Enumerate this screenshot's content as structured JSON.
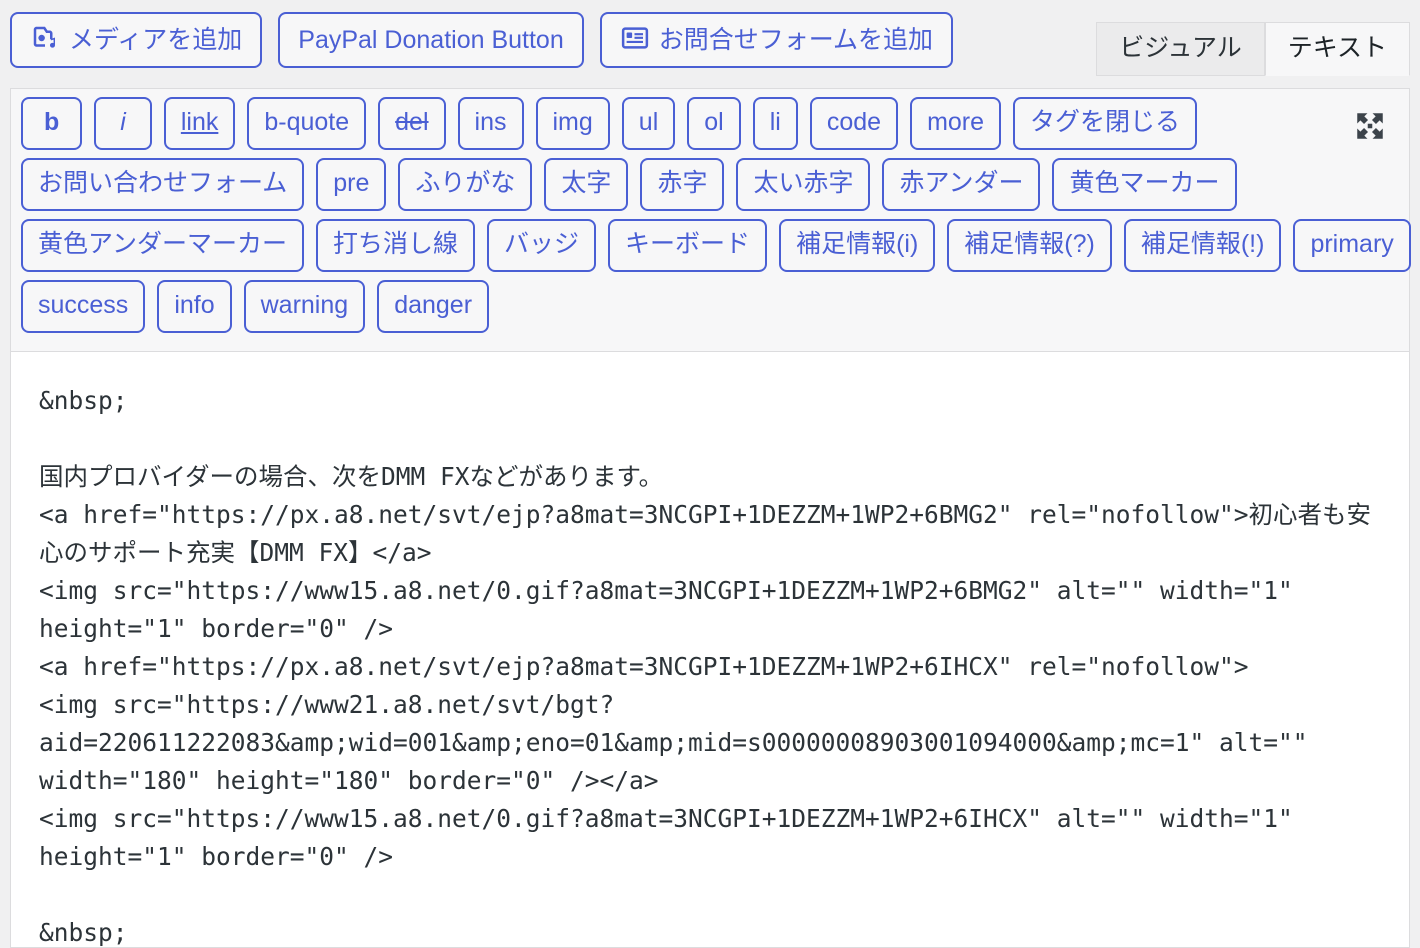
{
  "media_bar": {
    "buttons": [
      {
        "label": "メディアを追加",
        "icon": "media-add-icon",
        "has_icon": true
      },
      {
        "label": "PayPal Donation Button",
        "icon": "",
        "has_icon": false
      },
      {
        "label": "お問合せフォームを追加",
        "icon": "contact-form-icon",
        "has_icon": true
      }
    ]
  },
  "mode_tabs": [
    {
      "label": "ビジュアル",
      "active": false
    },
    {
      "label": "テキスト",
      "active": true
    }
  ],
  "quicktags": {
    "fullscreen_icon": "fullscreen-expand-icon",
    "rows": [
      [
        {
          "label": "b",
          "style": "s-bold"
        },
        {
          "label": "i",
          "style": "s-italic"
        },
        {
          "label": "link",
          "style": "s-underline"
        },
        {
          "label": "b-quote",
          "style": ""
        },
        {
          "label": "del",
          "style": "s-strike"
        },
        {
          "label": "ins",
          "style": ""
        },
        {
          "label": "img",
          "style": ""
        },
        {
          "label": "ul",
          "style": ""
        },
        {
          "label": "ol",
          "style": ""
        },
        {
          "label": "li",
          "style": ""
        },
        {
          "label": "code",
          "style": ""
        },
        {
          "label": "more",
          "style": ""
        },
        {
          "label": "タグを閉じる",
          "style": ""
        }
      ],
      [
        {
          "label": "お問い合わせフォーム",
          "style": ""
        },
        {
          "label": "pre",
          "style": ""
        },
        {
          "label": "ふりがな",
          "style": ""
        },
        {
          "label": "太字",
          "style": ""
        },
        {
          "label": "赤字",
          "style": ""
        },
        {
          "label": "太い赤字",
          "style": ""
        },
        {
          "label": "赤アンダー",
          "style": ""
        },
        {
          "label": "黄色マーカー",
          "style": ""
        }
      ],
      [
        {
          "label": "黄色アンダーマーカー",
          "style": ""
        },
        {
          "label": "打ち消し線",
          "style": ""
        },
        {
          "label": "バッジ",
          "style": ""
        },
        {
          "label": "キーボード",
          "style": ""
        },
        {
          "label": "補足情報(i)",
          "style": ""
        },
        {
          "label": "補足情報(?)",
          "style": ""
        },
        {
          "label": "補足情報(!)",
          "style": ""
        },
        {
          "label": "primary",
          "style": ""
        }
      ],
      [
        {
          "label": "success",
          "style": ""
        },
        {
          "label": "info",
          "style": ""
        },
        {
          "label": "warning",
          "style": ""
        },
        {
          "label": "danger",
          "style": ""
        }
      ]
    ]
  },
  "editor": {
    "content": "&nbsp;\n\n国内プロバイダーの場合、次をDMM FXなどがあります。\n<a href=\"https://px.a8.net/svt/ejp?a8mat=3NCGPI+1DEZZM+1WP2+6BMG2\" rel=\"nofollow\">初心者も安心のサポート充実【DMM FX】</a>\n<img src=\"https://www15.a8.net/0.gif?a8mat=3NCGPI+1DEZZM+1WP2+6BMG2\" alt=\"\" width=\"1\" height=\"1\" border=\"0\" />\n<a href=\"https://px.a8.net/svt/ejp?a8mat=3NCGPI+1DEZZM+1WP2+6IHCX\" rel=\"nofollow\">\n<img src=\"https://www21.a8.net/svt/bgt?aid=220611222083&amp;wid=001&amp;eno=01&amp;mid=s00000008903001094000&amp;mc=1\" alt=\"\" width=\"180\" height=\"180\" border=\"0\" /></a>\n<img src=\"https://www15.a8.net/0.gif?a8mat=3NCGPI+1DEZZM+1WP2+6IHCX\" alt=\"\" width=\"1\" height=\"1\" border=\"0\" />\n\n&nbsp;"
  },
  "colors": {
    "accent": "#4a5fd4",
    "page_bg": "#f0f0f1",
    "panel_bg": "#f7f7f8",
    "border": "#dcdcde",
    "text": "#2c3338"
  }
}
